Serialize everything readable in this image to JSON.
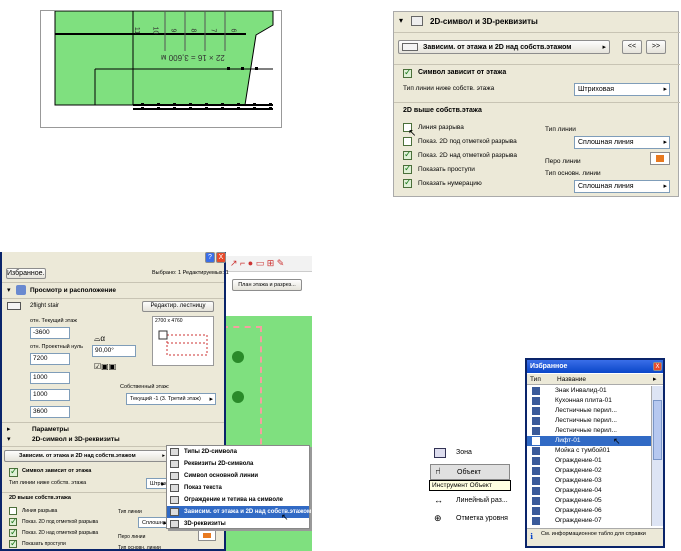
{
  "plan": {
    "dim_label": "22 × 16 = 3,600 м",
    "step_numbers": [
      "11",
      "10",
      "9",
      "8",
      "7",
      "6"
    ]
  },
  "panel_top": {
    "title": "2D-символ и 3D-реквизиты",
    "mode_select": "Зависим. от этажа и 2D над собств.этажом",
    "prev_label": "<<",
    "next_label": ">>",
    "symbol_depends_label": "Символ зависит от этажа",
    "below_line_type_label": "Тип линии ниже собств. этажа",
    "below_line_type_value": "Штриховая",
    "above_header": "2D выше собств.этажа",
    "items": [
      "Линия разрыва",
      "Показ. 2D под отметкой разрыва",
      "Показ. 2D над отметкой разрыва",
      "Показать проступи",
      "Показать нумерацию"
    ],
    "line_type_label": "Тип линии",
    "line_type_value": "Сплошная линия",
    "pen_label": "Перо линии",
    "base_line_type_label": "Тип основн. линии",
    "base_line_type_value": "Сплошная линия"
  },
  "dialog": {
    "favorites_btn": "Избранное...",
    "selection_info": "Выбрано: 1 Редактируемых: 1",
    "floor_plan_btn": "План этажа и разрез...",
    "section_view": "Просмотр и расположение",
    "stair_name": "2flight stair",
    "edit_stair_btn": "Редактир. лестницу",
    "rel_floor_label": "отн. Текущий этаж",
    "rel_floor_value": "-3600",
    "rel_project_label": "отн. Проектный нуль",
    "rel_project_value": "7200",
    "angle_value": "90,00°",
    "size_label": "2700 x 4760",
    "val1": "1000",
    "val2": "1000",
    "val3": "3600",
    "own_floor_label": "Собственный этаж:",
    "own_floor_value": "Текущий -1 (3. Третий этаж)",
    "section_params": "Параметры",
    "section_2d3d": "2D-символ и 3D-реквизиты",
    "mode_select": "Зависим. от этажа и 2D над собств.этажом",
    "symbol_depends_label": "Символ зависит от этажа",
    "below_line_type_label": "Тип линии ниже собств. этажа",
    "below_line_type_value": "Штриховая",
    "above_header": "2D выше собств.этажа",
    "items": [
      "Линия разрыва",
      "Показ. 2D под отметкой разрыва",
      "Показ. 2D над отметкой разрыва",
      "Показать проступи"
    ],
    "line_type_label": "Тип линии",
    "line_type_value": "Сплошная л",
    "pen_label": "Перо линии",
    "base_line_label": "Тип основн. линии",
    "help_btn": "?",
    "close_btn": "X"
  },
  "popup_menu": {
    "items": [
      "Типы 2D-символа",
      "Реквизиты 2D-символа",
      "Символ основной линии",
      "Показ текста",
      "Ограждение и тетива на символе",
      "Зависим. от этажа и 2D над собств.этажом",
      "3D-реквизиты"
    ],
    "selected_index": 5
  },
  "toolbox": {
    "items": [
      "Зона",
      "Объект",
      "Линейный раз...",
      "Отметка уровня"
    ],
    "tooltip": "Инструмент Объект"
  },
  "favorites": {
    "title": "Избранное",
    "col_type": "Тип",
    "col_name": "Название",
    "rows": [
      "Знак Инвалид-01",
      "Кухонная плита-01",
      "Лестничные перил...",
      "Лестничные перил...",
      "Лестничные перил...",
      "Лифт-01",
      "Мойка с тумбой01",
      "Ограждение-01",
      "Ограждение-02",
      "Ограждение-03",
      "Ограждение-04",
      "Ограждение-05",
      "Ограждение-06",
      "Ограждение-07"
    ],
    "selected_index": 5,
    "footer": "См. информационное табло для справки",
    "close_btn": "X"
  },
  "colors": {
    "plan_green": "#7fe07f",
    "xp_blue": "#0a246a",
    "dialog_bg": "#ece9d8",
    "pen_orange": "#e87a20"
  }
}
